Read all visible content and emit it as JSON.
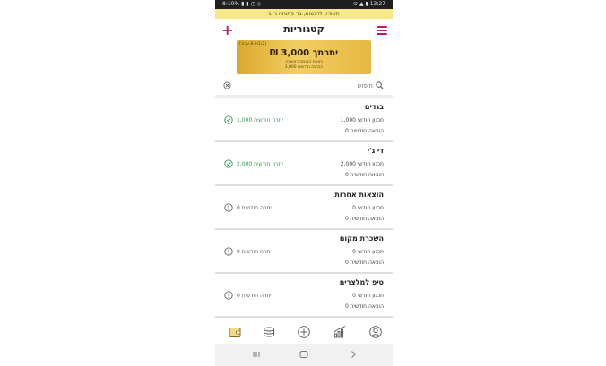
{
  "status_bar": {
    "left": "8:10% ▮ ▮ ◷ ◇",
    "right": "⊙ ▲ ▮ 13:27"
  },
  "notice": "תשפיע לרגשות, בר פתוחה נ״ב",
  "header": {
    "title": "קטגוריות"
  },
  "balance": {
    "date": "(8-2/1/2 עבור)",
    "amount": "יתרתך 3,000 ₪",
    "line1": "בצעת הכנסה ראשונה",
    "line2": "הכנסה חודשית 3,000"
  },
  "search": {
    "placeholder": "חיפוש"
  },
  "categories": [
    {
      "name": "בגדים",
      "plan": "תכנון חודשי 1,000",
      "expense": "הוצאה חודשית 0",
      "remain": "יתרה חודשית 1,000",
      "state": "pos"
    },
    {
      "name": "די ג'י",
      "plan": "תכנון חודשי 2,000",
      "expense": "הוצאה חודשית 0",
      "remain": "יתרה חודשית 2,000",
      "state": "pos"
    },
    {
      "name": "הוצאות אחרות",
      "plan": "תכנון חודשי 0",
      "expense": "הוצאה חודשית 0",
      "remain": "יתרה חודשית 0",
      "state": "zero"
    },
    {
      "name": "השכרת מקום",
      "plan": "תכנון חודשי 0",
      "expense": "הוצאה חודשית 0",
      "remain": "יתרה חודשית 0",
      "state": "zero"
    },
    {
      "name": "טיפ למלצרים",
      "plan": "תכנון חודשי 0",
      "expense": "הוצאה חודשית 0",
      "remain": "יתרה חודשית 0",
      "state": "zero"
    }
  ],
  "bottom_nav": [
    {
      "icon": "wallet-icon"
    },
    {
      "icon": "coins-icon"
    },
    {
      "icon": "add-circle-icon"
    },
    {
      "icon": "chart-icon"
    },
    {
      "icon": "profile-icon"
    }
  ],
  "system_nav": [
    {
      "icon": "recents-icon"
    },
    {
      "icon": "home-icon"
    },
    {
      "icon": "back-icon"
    }
  ],
  "colors": {
    "accent": "#c2186b",
    "positive": "#2e9b4f",
    "card_gold": "#f2cf63",
    "notice_bg": "#f7e98a"
  }
}
